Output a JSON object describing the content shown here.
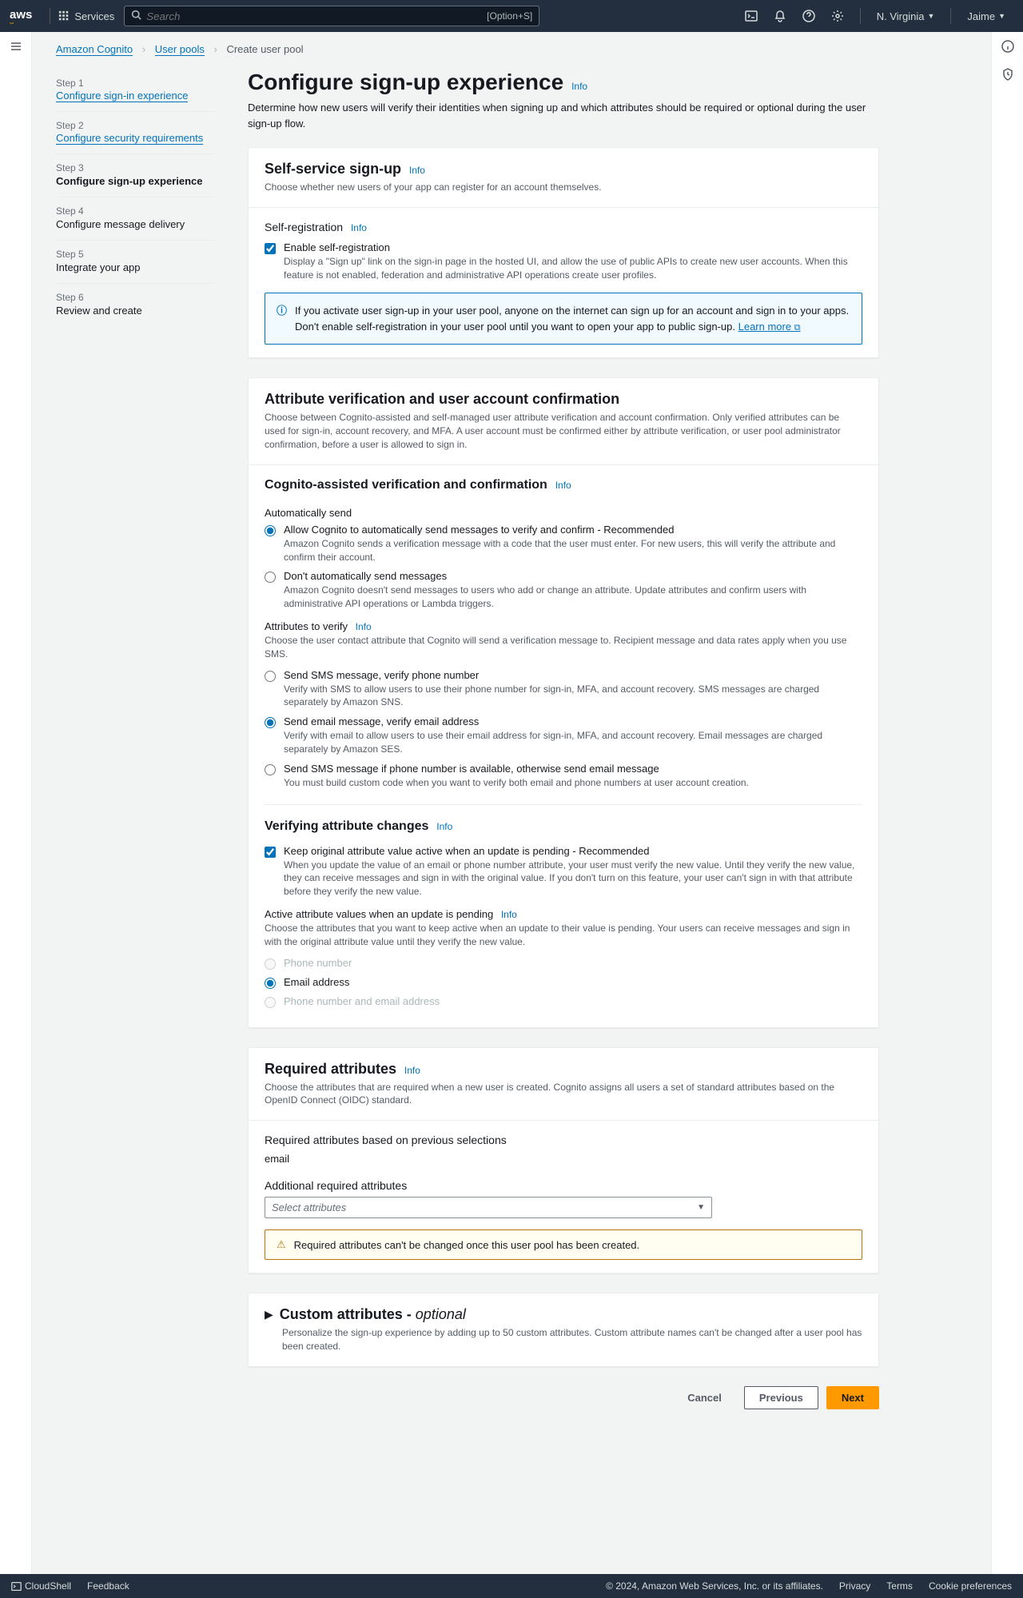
{
  "nav": {
    "logo": "aws",
    "services": "Services",
    "search_placeholder": "Search",
    "search_kbd": "[Option+S]",
    "region": "N. Virginia",
    "user": "Jaime"
  },
  "breadcrumb": {
    "a": "Amazon Cognito",
    "b": "User pools",
    "c": "Create user pool"
  },
  "steps": [
    {
      "num": "Step 1",
      "title": "Configure sign-in experience",
      "link": true
    },
    {
      "num": "Step 2",
      "title": "Configure security requirements",
      "link": true
    },
    {
      "num": "Step 3",
      "title": "Configure sign-up experience",
      "current": true
    },
    {
      "num": "Step 4",
      "title": "Configure message delivery"
    },
    {
      "num": "Step 5",
      "title": "Integrate your app"
    },
    {
      "num": "Step 6",
      "title": "Review and create"
    }
  ],
  "page": {
    "title": "Configure sign-up experience",
    "info": "Info",
    "desc": "Determine how new users will verify their identities when signing up and which attributes should be required or optional during the user sign-up flow."
  },
  "self_service": {
    "title": "Self-service sign-up",
    "info": "Info",
    "desc": "Choose whether new users of your app can register for an account themselves.",
    "sub_title": "Self-registration",
    "sub_info": "Info",
    "check_label": "Enable self-registration",
    "check_desc": "Display a \"Sign up\" link on the sign-in page in the hosted UI, and allow the use of public APIs to create new user accounts. When this feature is not enabled, federation and administrative API operations create user profiles.",
    "alert_text": "If you activate user sign-up in your user pool, anyone on the internet can sign up for an account and sign in to your apps. Don't enable self-registration in your user pool until you want to open your app to public sign-up. ",
    "alert_link": "Learn more"
  },
  "attr_verif": {
    "title": "Attribute verification and user account confirmation",
    "desc": "Choose between Cognito-assisted and self-managed user attribute verification and account confirmation. Only verified attributes can be used for sign-in, account recovery, and MFA. A user account must be confirmed either by attribute verification, or user pool administrator confirmation, before a user is allowed to sign in."
  },
  "cognito_assist": {
    "title": "Cognito-assisted verification and confirmation",
    "info": "Info",
    "auto_send": "Automatically send",
    "r1_label": "Allow Cognito to automatically send messages to verify and confirm - Recommended",
    "r1_desc": "Amazon Cognito sends a verification message with a code that the user must enter. For new users, this will verify the attribute and confirm their account.",
    "r2_label": "Don't automatically send messages",
    "r2_desc": "Amazon Cognito doesn't send messages to users who add or change an attribute. Update attributes and confirm users with administrative API operations or Lambda triggers.",
    "attrs_title": "Attributes to verify",
    "attrs_info": "Info",
    "attrs_desc": "Choose the user contact attribute that Cognito will send a verification message to. Recipient message and data rates apply when you use SMS.",
    "v1_label": "Send SMS message, verify phone number",
    "v1_desc": "Verify with SMS to allow users to use their phone number for sign-in, MFA, and account recovery. SMS messages are charged separately by Amazon SNS.",
    "v2_label": "Send email message, verify email address",
    "v2_desc": "Verify with email to allow users to use their email address for sign-in, MFA, and account recovery. Email messages are charged separately by Amazon SES.",
    "v3_label": "Send SMS message if phone number is available, otherwise send email message",
    "v3_desc": "You must build custom code when you want to verify both email and phone numbers at user account creation."
  },
  "verify_changes": {
    "title": "Verifying attribute changes",
    "info": "Info",
    "c1_label": "Keep original attribute value active when an update is pending - Recommended",
    "c1_desc": "When you update the value of an email or phone number attribute, your user must verify the new value. Until they verify the new value, they can receive messages and sign in with the original value. If you don't turn on this feature, your user can't sign in with that attribute before they verify the new value.",
    "active_title": "Active attribute values when an update is pending",
    "active_info": "Info",
    "active_desc": "Choose the attributes that you want to keep active when an update to their value is pending. Your users can receive messages and sign in with the original attribute value until they verify the new value.",
    "opt_phone": "Phone number",
    "opt_email": "Email address",
    "opt_both": "Phone number and email address"
  },
  "required": {
    "title": "Required attributes",
    "info": "Info",
    "desc": "Choose the attributes that are required when a new user is created. Cognito assigns all users a set of standard attributes based on the OpenID Connect (OIDC) standard.",
    "prev_title": "Required attributes based on previous selections",
    "prev_value": "email",
    "addl_title": "Additional required attributes",
    "select_ph": "Select attributes",
    "warn": "Required attributes can't be changed once this user pool has been created."
  },
  "custom": {
    "title": "Custom attributes - ",
    "optional": "optional",
    "desc": "Personalize the sign-up experience by adding up to 50 custom attributes. Custom attribute names can't be changed after a user pool has been created."
  },
  "buttons": {
    "cancel": "Cancel",
    "previous": "Previous",
    "next": "Next"
  },
  "footer": {
    "cloudshell": "CloudShell",
    "feedback": "Feedback",
    "copyright": "© 2024, Amazon Web Services, Inc. or its affiliates.",
    "privacy": "Privacy",
    "terms": "Terms",
    "cookie": "Cookie preferences"
  }
}
